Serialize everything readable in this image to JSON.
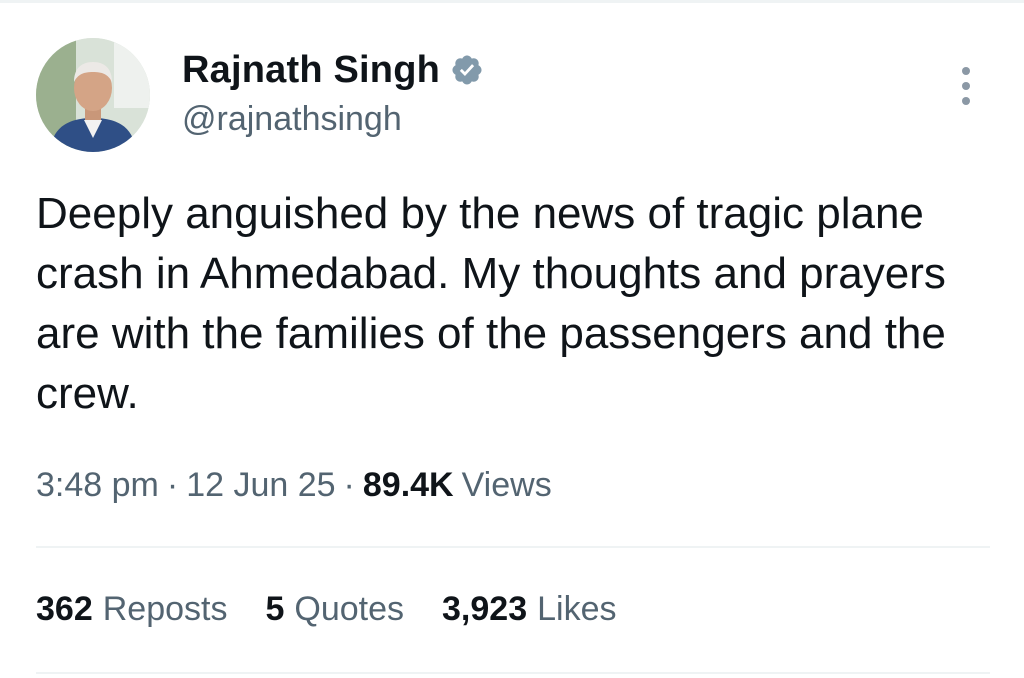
{
  "author": {
    "display_name": "Rajnath Singh",
    "handle": "@rajnathsingh",
    "verified": true,
    "verified_badge_color": "#829aab"
  },
  "tweet": {
    "text": "Deeply anguished by the news of tragic plane crash in Ahmedabad. My thoughts and prayers are with the families of the passengers and the crew.",
    "time": "3:48 pm",
    "separator": "·",
    "date": "12 Jun 25",
    "views_count": "89.4K",
    "views_label": "Views"
  },
  "stats": {
    "reposts": {
      "count": "362",
      "label": "Reposts"
    },
    "quotes": {
      "count": "5",
      "label": "Quotes"
    },
    "likes": {
      "count": "3,923",
      "label": "Likes"
    }
  },
  "icons": {
    "more": "more-vertical-icon",
    "verified": "verified-badge-icon"
  },
  "colors": {
    "text_primary": "#0f1419",
    "text_secondary": "#536471",
    "divider": "#eff3f4"
  }
}
